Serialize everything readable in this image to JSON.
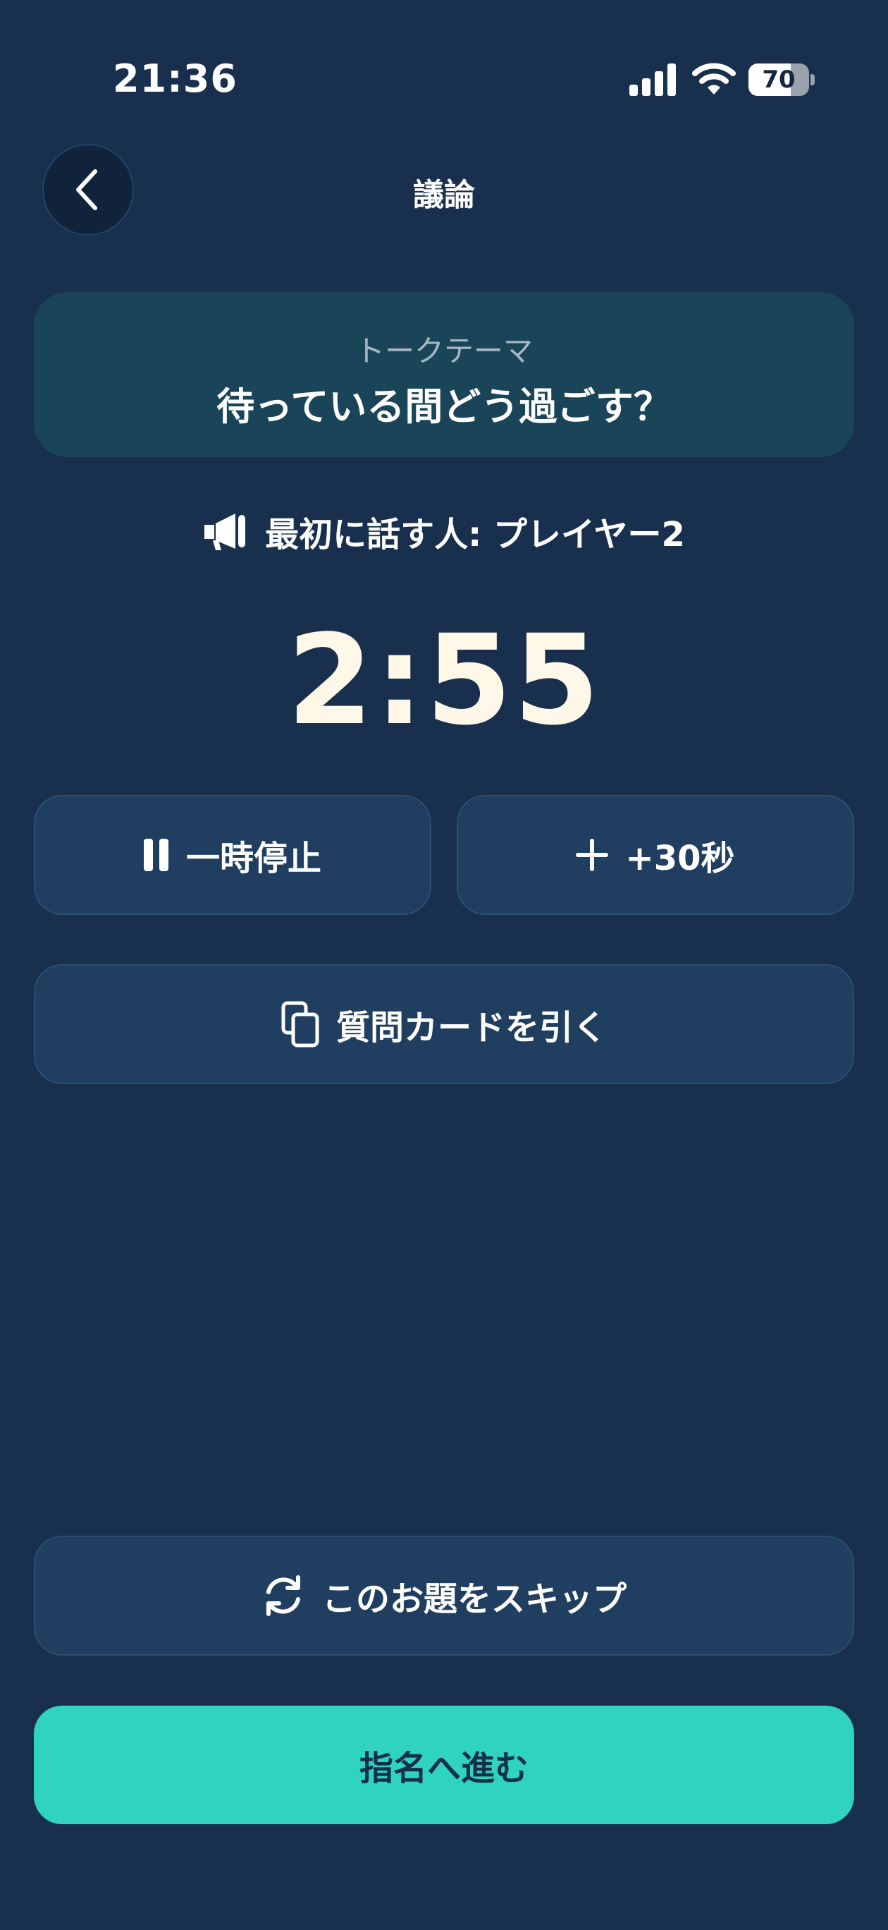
{
  "status_bar": {
    "time": "21:36",
    "battery_level": "70",
    "battery_fraction": 0.7
  },
  "header": {
    "title": "議論",
    "back_icon": "chevron-left-icon"
  },
  "topic": {
    "label": "トークテーマ",
    "text": "待っている間どう過ごす？"
  },
  "first_speaker": {
    "icon": "megaphone-icon",
    "text": "最初に話す人: プレイヤー2"
  },
  "timer": {
    "display": "2:55"
  },
  "controls": {
    "pause_label": "一時停止",
    "add_time_label": "+30秒",
    "draw_card_label": "質問カードを引く",
    "skip_label": "このお題をスキップ",
    "proceed_label": "指名へ進む"
  },
  "colors": {
    "background": "#18304d",
    "accent": "#2fd3be",
    "card": "#1a4559",
    "button": "#1f3e60"
  }
}
